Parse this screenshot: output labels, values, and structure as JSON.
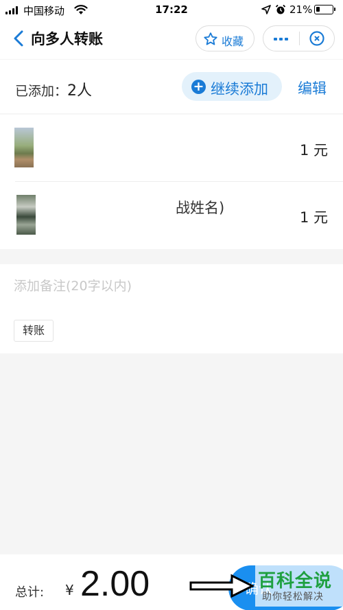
{
  "status_bar": {
    "carrier": "中国移动",
    "time": "17:22",
    "battery": "21%",
    "battery_level": 0.21,
    "icons": [
      "signal-icon",
      "wifi-icon",
      "location-arrow-icon",
      "alarm-clock-icon",
      "battery-icon"
    ]
  },
  "nav": {
    "title": "向多人转账",
    "favorite_label": "收藏",
    "icons": {
      "back": "chevron-left-icon",
      "favorite": "star-icon",
      "more": "more-dots-icon",
      "close": "close-target-icon"
    }
  },
  "added": {
    "label": "已添加：",
    "count": "2人",
    "add_more_label": "继续添加",
    "edit_label": "编辑"
  },
  "recipients": [
    {
      "name": "",
      "amount": "1 元"
    },
    {
      "name": "战姓名)",
      "amount": "1 元"
    }
  ],
  "remark": {
    "placeholder": "添加备注(20字以内)",
    "value": "",
    "tag": "转账"
  },
  "footer": {
    "total_label": "总计:",
    "currency": "¥",
    "total": "2.00",
    "confirm_label": "确认"
  },
  "watermark": {
    "title": "百科全说",
    "subtitle": "助你轻松解决"
  },
  "colors": {
    "accent": "#1a7bd6",
    "button": "#1a8ff0",
    "add_more_bg": "#e3f1fb",
    "page_bg": "#f5f5f5",
    "watermark": "#1fa040"
  }
}
